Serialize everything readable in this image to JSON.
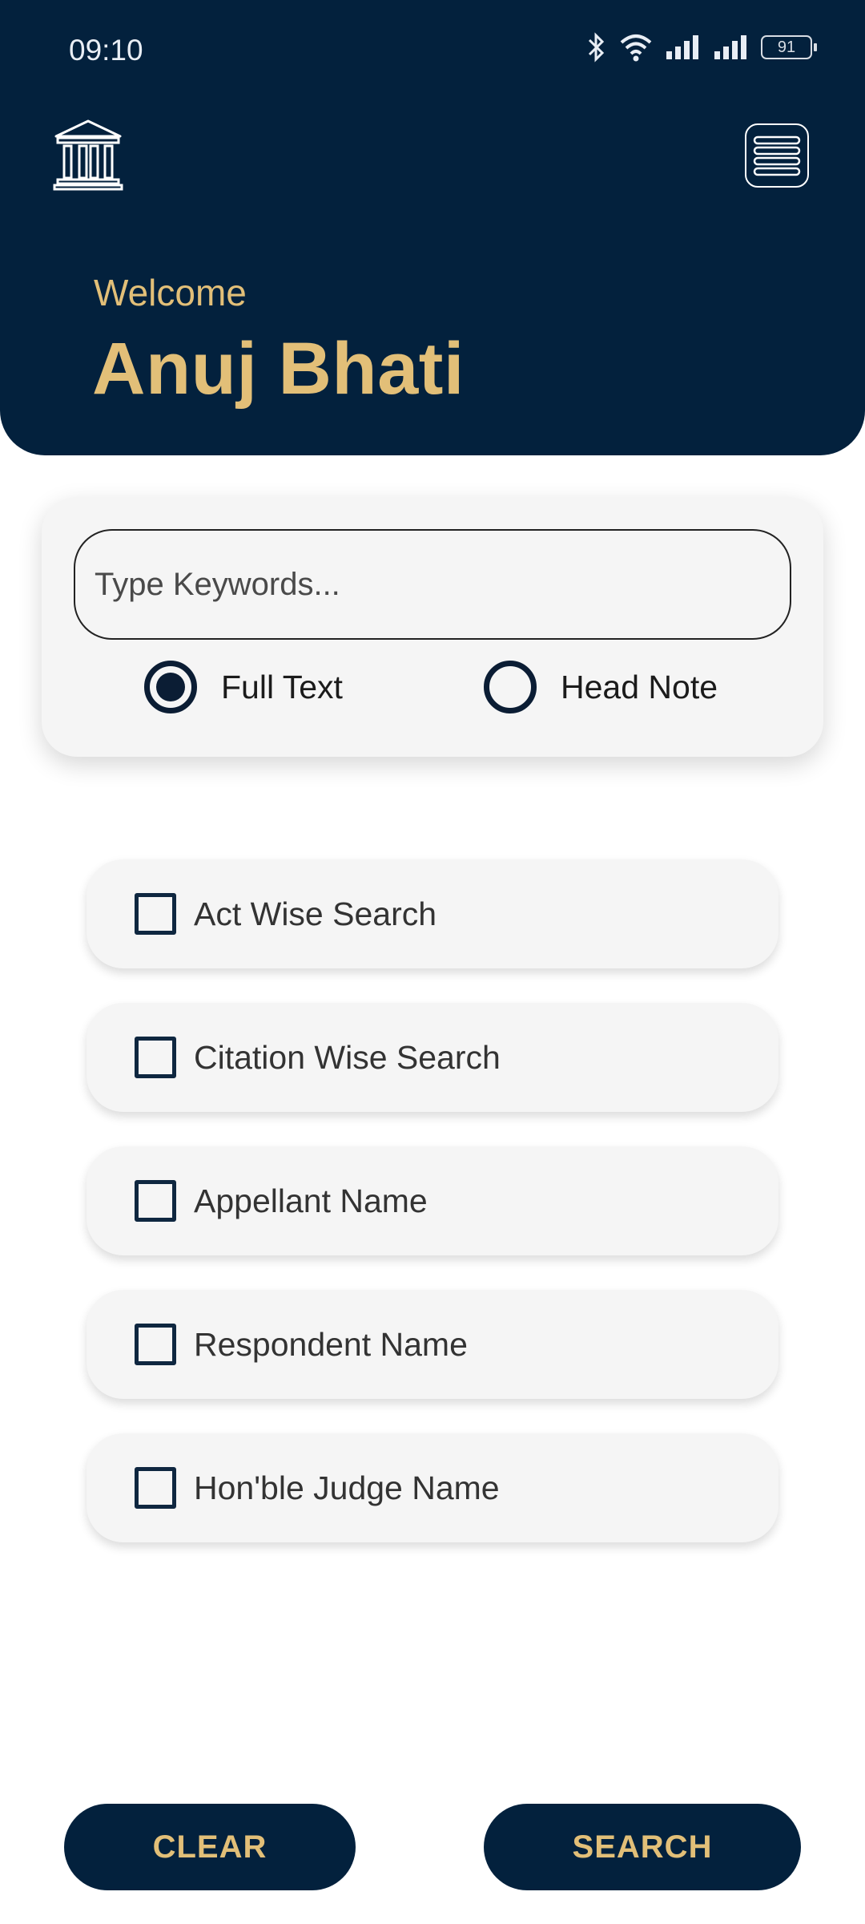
{
  "status_bar": {
    "time": "09:10",
    "battery": "91"
  },
  "header": {
    "welcome": "Welcome",
    "user_name": "Anuj Bhati"
  },
  "search": {
    "placeholder": "Type Keywords...",
    "value": "",
    "radio_options": [
      {
        "label": "Full Text",
        "selected": true
      },
      {
        "label": "Head Note",
        "selected": false
      }
    ]
  },
  "filters": [
    {
      "label": "Act Wise Search",
      "checked": false
    },
    {
      "label": "Citation Wise Search",
      "checked": false
    },
    {
      "label": "Appellant Name",
      "checked": false
    },
    {
      "label": "Respondent Name",
      "checked": false
    },
    {
      "label": "Hon'ble Judge Name",
      "checked": false
    }
  ],
  "actions": {
    "clear_label": "CLEAR",
    "search_label": "SEARCH"
  },
  "colors": {
    "navy": "#03213d",
    "gold": "#e2bf78",
    "card": "#f5f5f5"
  }
}
